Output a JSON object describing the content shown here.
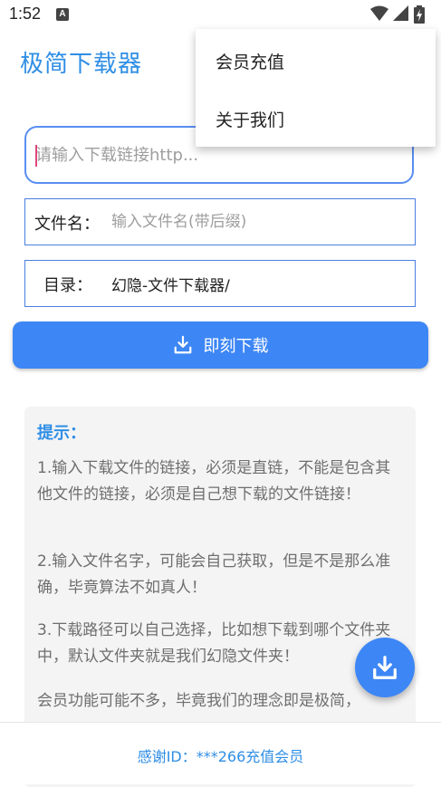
{
  "status_bar": {
    "time": "1:52",
    "notification_icon": "A"
  },
  "app": {
    "title": "极简下载器"
  },
  "link_input": {
    "placeholder": "请输入下载链接http...",
    "value": ""
  },
  "filename_field": {
    "label": "文件名：",
    "placeholder": "输入文件名(带后缀)",
    "value": ""
  },
  "directory_field": {
    "label": "目录：",
    "value": "幻隐-文件下载器/"
  },
  "download_button": {
    "label": "即刻下载",
    "icon": "download-icon"
  },
  "tips": {
    "title": "提示：",
    "paragraphs": [
      "1.输入下载文件的链接，必须是直链，不能是包含其他文件的链接，必须是自己想下载的文件链接！",
      "2.输入文件名字，可能会自己获取，但是不是那么准确，毕竟算法不如真人！",
      "3.下载路径可以自己选择，比如想下载到哪个文件夹中，默认文件夹就是我们幻隐文件夹！",
      "会员功能可能不多，毕竟我们的理念即是极简，"
    ]
  },
  "bottom_bar": {
    "text": "感谢ID：***266充值会员"
  },
  "overflow_menu": {
    "items": [
      {
        "label": "会员充值"
      },
      {
        "label": "关于我们"
      }
    ]
  },
  "colors": {
    "accent": "#3d86f5",
    "title_blue": "#2f8ee5",
    "field_border": "#4a7fe0"
  }
}
